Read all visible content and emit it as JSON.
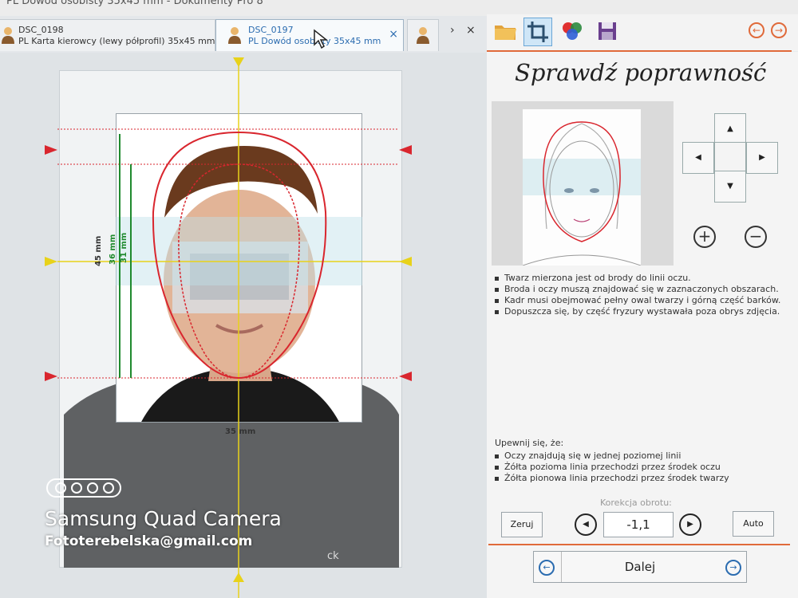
{
  "window": {
    "title": "PL Dowód osobisty 35x45 mm - Dokumenty Pro 8"
  },
  "tabs": [
    {
      "name": "DSC_0198",
      "desc": "PL Karta kierowcy (lewy półprofil) 35x45 mm",
      "active": false
    },
    {
      "name": "DSC_0197",
      "desc": "PL Dowód osobisty 35x45 mm",
      "active": true,
      "close": "×"
    }
  ],
  "tab_scroll": {
    "right": "›",
    "close": "×"
  },
  "toolbar": {
    "icons": [
      "open-folder-icon",
      "crop-icon",
      "color-correction-icon",
      "save-icon"
    ],
    "back": "←",
    "forward": "→"
  },
  "editor": {
    "height_label": "45 mm",
    "width_label": "35 mm",
    "face_max_label": "36 mm",
    "face_min_label": "31 mm",
    "shirt_logo": "ck"
  },
  "panel": {
    "heading": "Sprawdź poprawność",
    "arrows": {
      "up": "▲",
      "left": "◀",
      "right": "▶",
      "down": "▼"
    },
    "zoom_in": "+",
    "zoom_out": "−",
    "rules": [
      "Twarz mierzona jest od brody do linii oczu.",
      "Broda i oczy muszą znajdować się w zaznaczonych obszarach.",
      "Kadr musi obejmować pełny owal twarzy i górną część barków.",
      "Dopuszcza się, by część fryzury wystawała poza obrys zdjęcia."
    ],
    "ensure_label": "Upewnij się, że:",
    "ensure": [
      "Oczy znajdują się w jednej poziomej linii",
      "Żółta pozioma linia przechodzi przez środek oczu",
      "Żółta pionowa linia przechodzi przez środek twarzy"
    ],
    "rotation_label": "Korekcja obrotu:",
    "reset": "Zeruj",
    "rot_left": "◀",
    "rot_value": "-1,1",
    "rot_right": "▶",
    "auto": "Auto",
    "next": "Dalej",
    "next_prev": "←",
    "next_next": "→"
  },
  "watermark": {
    "camera": "Samsung Quad Camera",
    "email": "Fototerebelska@gmail.com"
  },
  "colors": {
    "accent": "#e06a3a",
    "link": "#2b6cb0",
    "guide_red": "#d9262e",
    "guide_yellow": "#e8d21a",
    "guide_green": "#1f8a2e"
  }
}
